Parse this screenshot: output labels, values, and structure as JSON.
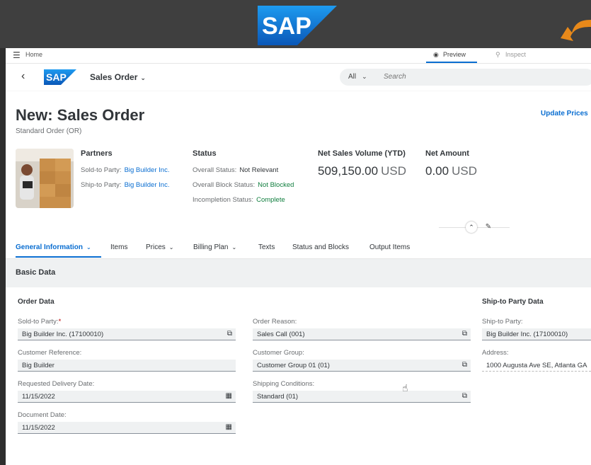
{
  "brand": {
    "logo_text": "SAP"
  },
  "shell": {
    "home_label": "Home",
    "preview_label": "Preview",
    "inspect_label": "Inspect"
  },
  "appbar": {
    "app_title": "Sales Order",
    "search_scope": "All",
    "search_placeholder": "Search"
  },
  "header": {
    "title": "New: Sales Order",
    "subtitle": "Standard Order (OR)",
    "update_prices": "Update Prices",
    "partners": {
      "title": "Partners",
      "sold_to_label": "Sold-to Party:",
      "sold_to_value": "Big Builder Inc.",
      "ship_to_label": "Ship-to Party:",
      "ship_to_value": "Big Builder Inc."
    },
    "status": {
      "title": "Status",
      "overall_label": "Overall Status:",
      "overall_value": "Not Relevant",
      "block_label": "Overall Block Status:",
      "block_value": "Not Blocked",
      "incompletion_label": "Incompletion Status:",
      "incompletion_value": "Complete"
    },
    "net_sales": {
      "title": "Net Sales Volume (YTD)",
      "amount": "509,150.00",
      "currency": "USD"
    },
    "net_amount": {
      "title": "Net Amount",
      "amount": "0.00",
      "currency": "USD"
    }
  },
  "tabs": [
    {
      "label": "General Information",
      "has_menu": true
    },
    {
      "label": "Items"
    },
    {
      "label": "Prices",
      "has_menu": true
    },
    {
      "label": "Billing Plan",
      "has_menu": true
    },
    {
      "label": "Texts"
    },
    {
      "label": "Status and Blocks"
    },
    {
      "label": "Output Items"
    }
  ],
  "section": {
    "title": "Basic Data"
  },
  "order_data": {
    "title": "Order Data",
    "sold_to_label": "Sold-to Party:",
    "sold_to_value": "Big Builder Inc. (17100010)",
    "customer_ref_label": "Customer Reference:",
    "customer_ref_value": "Big Builder",
    "req_delivery_label": "Requested Delivery Date:",
    "req_delivery_value": "11/15/2022",
    "doc_date_label": "Document Date:",
    "doc_date_value": "11/15/2022"
  },
  "middle_data": {
    "order_reason_label": "Order Reason:",
    "order_reason_value": "Sales Call (001)",
    "customer_group_label": "Customer Group:",
    "customer_group_value": "Customer Group 01 (01)",
    "shipping_label": "Shipping Conditions:",
    "shipping_value": "Standard (01)"
  },
  "ship_to_data": {
    "title": "Ship-to Party Data",
    "ship_to_label": "Ship-to Party:",
    "ship_to_value": "Big Builder Inc. (17100010)",
    "address_label": "Address:",
    "address_value": "1000 Augusta Ave SE, Atlanta GA"
  },
  "colors": {
    "brand_blue": "#0a6ed1",
    "positive": "#107e3e",
    "orange_arrow": "#e8891a"
  }
}
